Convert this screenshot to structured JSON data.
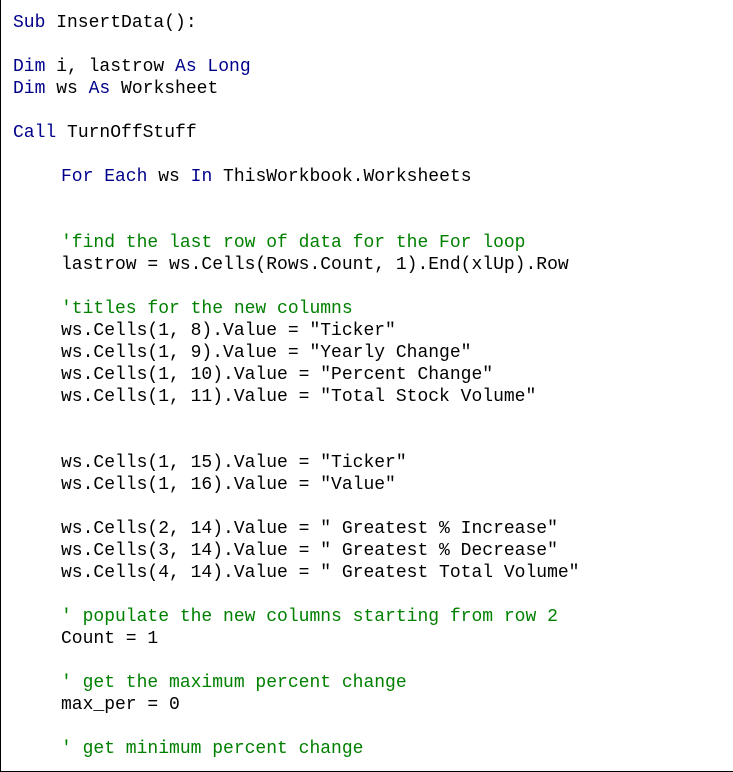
{
  "colors": {
    "keyword": "#00008b",
    "comment": "#008000",
    "text": "#000000",
    "background": "#ffffff"
  },
  "code": {
    "l1": {
      "kw": "Sub",
      "rest": " InsertData():"
    },
    "l3": {
      "kw": "Dim",
      "rest": " i, lastrow ",
      "kw2": "As Long"
    },
    "l4": {
      "kw": "Dim",
      "rest": " ws ",
      "kw2": "As",
      "rest2": " Worksheet"
    },
    "l6": {
      "kw": "Call",
      "rest": " TurnOffStuff"
    },
    "l8": {
      "kw": "For Each",
      "rest": " ws ",
      "kw2": "In",
      "rest2": " ThisWorkbook.Worksheets"
    },
    "l11": {
      "comment": "'find the last row of data for the For loop"
    },
    "l12": {
      "text": "lastrow = ws.Cells(Rows.Count, 1).End(xlUp).Row"
    },
    "l14": {
      "comment": "'titles for the new columns"
    },
    "l15": {
      "text": "ws.Cells(1, 8).Value = \"Ticker\""
    },
    "l16": {
      "text": "ws.Cells(1, 9).Value = \"Yearly Change\""
    },
    "l17": {
      "text": "ws.Cells(1, 10).Value = \"Percent Change\""
    },
    "l18": {
      "text": "ws.Cells(1, 11).Value = \"Total Stock Volume\""
    },
    "l21": {
      "text": "ws.Cells(1, 15).Value = \"Ticker\""
    },
    "l22": {
      "text": "ws.Cells(1, 16).Value = \"Value\""
    },
    "l24": {
      "text": "ws.Cells(2, 14).Value = \" Greatest % Increase\""
    },
    "l25": {
      "text": "ws.Cells(3, 14).Value = \" Greatest % Decrease\""
    },
    "l26": {
      "text": "ws.Cells(4, 14).Value = \" Greatest Total Volume\""
    },
    "l28": {
      "comment": "' populate the new columns starting from row 2"
    },
    "l29": {
      "text": "Count = 1"
    },
    "l31": {
      "comment": "' get the maximum percent change"
    },
    "l32": {
      "text": "max_per = 0"
    },
    "l34": {
      "comment": "' get minimum percent change"
    }
  }
}
